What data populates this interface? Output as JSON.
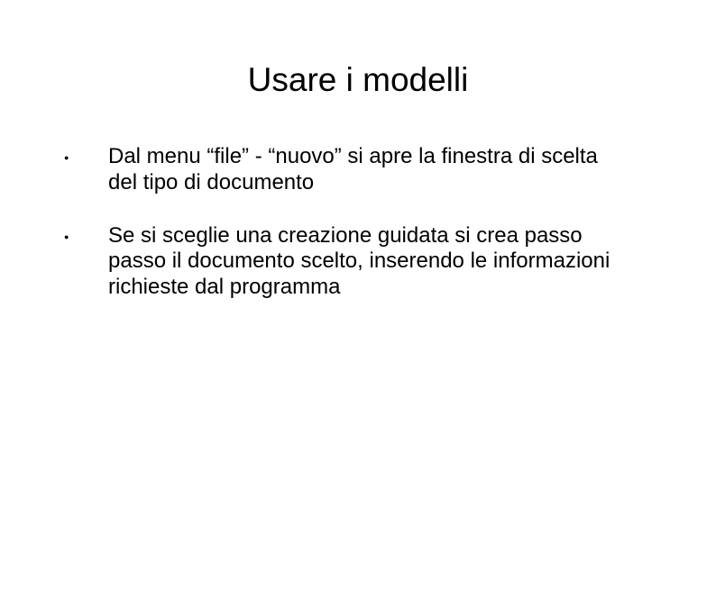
{
  "slide": {
    "title": "Usare i modelli",
    "bullets": [
      "Dal menu “file” - “nuovo” si apre la finestra di scelta del tipo di documento",
      "Se si sceglie una creazione guidata si crea passo passo il documento scelto, inserendo le informazioni richieste dal programma"
    ]
  }
}
